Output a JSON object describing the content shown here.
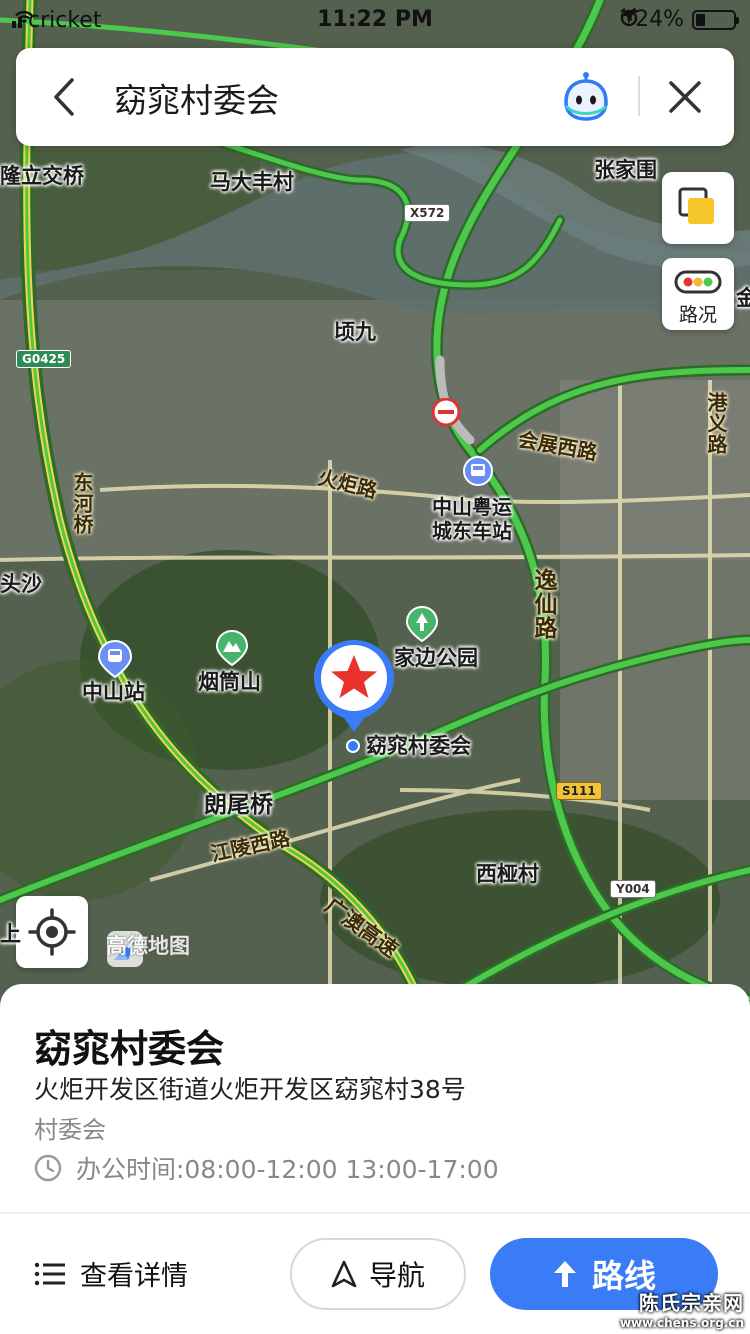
{
  "status_bar": {
    "carrier": "cricket",
    "time": "11:22 PM",
    "battery": "24%"
  },
  "search": {
    "title": "窈窕村委会"
  },
  "traffic_button": {
    "label": "路况"
  },
  "map_labels": {
    "madafeng": "马大丰村",
    "zhangjiawei": "张家围",
    "longli_bridge": "隆立交桥",
    "qingjiu": "顷九",
    "zhongshan_station_bus": "中山粤运",
    "zhongshan_station_bus2": "城东车站",
    "toucha": "头沙",
    "zhongshan_station": "中山站",
    "yantongshan": "烟筒山",
    "park": "家边公园",
    "poi": "窈窕村委会",
    "langwei_bridge": "朗尾桥",
    "xizhi_village": "西桠村",
    "shang": "上",
    "right_edge": "金"
  },
  "road_labels": {
    "donghe_bridge": "东河桥",
    "huoju_road": "火炬路",
    "huizhan_west": "会展西路",
    "gangyi_road": "港义路",
    "yixian_road": "逸仙路",
    "jiangling_west": "江陵西路",
    "guangao_expressway": "广澳高速"
  },
  "shields": {
    "x572": "X572",
    "g0425": "G0425",
    "s111": "S111",
    "y004": "Y004"
  },
  "logo": {
    "text": "高德地图"
  },
  "poi_card": {
    "name": "窈窕村委会",
    "address": "火炬开发区街道火炬开发区窈窕村38号",
    "category": "村委会",
    "hours": "办公时间:08:00-12:00 13:00-17:00"
  },
  "actions": {
    "details": "查看详情",
    "navigate": "导航",
    "route": "路线"
  },
  "watermark": {
    "line1": "陈氏宗亲网",
    "line2": "www.chens.org.cn"
  },
  "colors": {
    "accent": "#3a7cf6",
    "road_green": "#4cc84a",
    "road_yellow": "#f2d54a",
    "marker_red": "#e8322c"
  }
}
